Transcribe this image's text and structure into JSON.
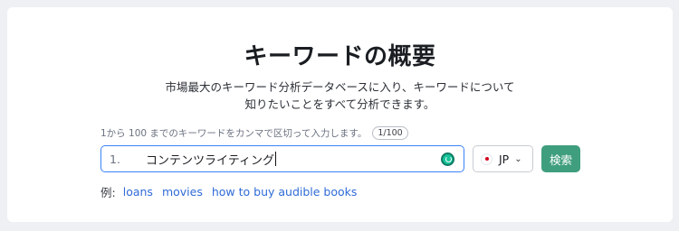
{
  "header": {
    "title": "キーワードの概要",
    "subtitle_line1": "市場最大のキーワード分析データベースに入り、キーワードについて",
    "subtitle_line2": "知りたいことをすべて分析できます。"
  },
  "form": {
    "hint": "1から 100 までのキーワードをカンマで区切って入力します。",
    "counter": "1/100",
    "line_number": "1.",
    "keyword_value": "コンテンツライティング",
    "country_code": "JP",
    "search_label": "検索"
  },
  "examples": {
    "label": "例:",
    "items": [
      "loans",
      "movies",
      "how to buy audible books"
    ]
  },
  "colors": {
    "accent_button": "#3f9e7e",
    "focus_border": "#3b82f6",
    "link": "#2f6bd6"
  },
  "icons": {
    "grammarly": "grammarly-icon",
    "flag": "japan-flag-icon",
    "chevron": "chevron-down-icon"
  }
}
